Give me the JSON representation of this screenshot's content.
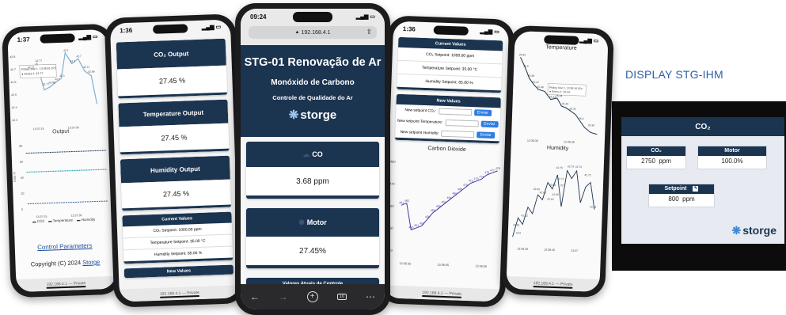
{
  "page": {
    "display_label": "DISPLAY STG-IHM"
  },
  "phone1": {
    "time": "1:37",
    "tooltip_line1": "Friday, Mar 1, 13:36:51.073",
    "tooltip_line2": "● Series 1: 42.77",
    "top_labels": [
      "42.77",
      "42.77",
      "42.77",
      "42.88",
      "42.1",
      "42.1",
      "42.1",
      "42.1",
      "42.7",
      "42.71",
      "42.66"
    ],
    "top_ticks_y": [
      "42.8",
      "42.7",
      "42.6",
      "42.5",
      "42.4",
      "42.3"
    ],
    "top_ticks_x": [
      "13:37:15",
      "13:37:30"
    ],
    "output_title": "Output",
    "output_ticks_y": [
      "80",
      "60",
      "40",
      "20",
      "0"
    ],
    "output_ylabel": "Data %",
    "output_ticks_x": [
      "13:37:15",
      "13:37:30"
    ],
    "legend": [
      "CO2",
      "Temperature",
      "Humidity"
    ],
    "link_text": "Control Parameters",
    "copyright_text": "Copyright (C) 2024 ",
    "copyright_link": "Storge",
    "url": "192.168.4.1 — Private"
  },
  "phone2": {
    "time": "1:36",
    "co2_title": "CO₂ Output",
    "co2_value": "27.45 %",
    "temp_title": "Temperature Output",
    "temp_value": "27.45 %",
    "hum_title": "Humidity Output",
    "hum_value": "27.45 %",
    "current_title": "Current Values",
    "co2_setpoint": "CO₂ Setpoint: 1000.00 ppm",
    "temp_setpoint": "Temperature Setpoint: 35.00 °C",
    "hum_setpoint": "Humidity Setpoint: 85.00 %",
    "new_values_title": "New Values",
    "url": "192.168.4.1 — Private"
  },
  "phone3": {
    "time": "09:24",
    "url": "192.168.4.1",
    "hero_title": "STG-01 Renovação de Ar",
    "hero_sub1": "Monóxido de Carbono",
    "hero_sub2": "Controle de Qualidade do Ar",
    "brand": "storge",
    "co_title": "CO",
    "co_value": "3.68 ppm",
    "motor_title": "Motor",
    "motor_value": "27.45%",
    "current_title": "Valores Atuais de Controle",
    "tab_count": "10"
  },
  "phone4": {
    "time": "1:36",
    "current_title": "Current Values",
    "co2_setpoint": "CO₂ Setpoint: 1000.00 ppm",
    "temp_setpoint": "Temperature Setpoint: 35.00 °C",
    "hum_setpoint": "Humidity Setpoint: 85.00 %",
    "new_values_title": "New Values",
    "new_co2_label": "New setpoint CO₂:",
    "new_temp_label": "New setpoint Temperature:",
    "new_hum_label": "New setpoint Humidity:",
    "send_label": "Enviar",
    "chart_title": "Carbon Dioxide",
    "chart_ticks_y": [
      "480",
      "470",
      "460",
      "450",
      "440"
    ],
    "chart_ticks_x": [
      "13:36:30",
      "13:36:45",
      "13:36:55"
    ],
    "point_labels": [
      "461",
      "462",
      "450",
      "451",
      "452",
      "455",
      "458",
      "460",
      "462",
      "464",
      "466",
      "468",
      "470",
      "472",
      "473",
      "474",
      "476",
      "477",
      "478"
    ],
    "url": "192.168.4.1 — Private"
  },
  "phone5": {
    "temp_title": "Temperature",
    "tooltip_line1": "Friday, Mar 1, 13:36:16.024",
    "tooltip_line2": "● Series 1: 25.44",
    "temp_labels": [
      "25.63",
      "25.5",
      "25.48",
      "25.47",
      "25.46",
      "25.44",
      "25.44",
      "25.43",
      "25.41",
      "25.4",
      "25.39"
    ],
    "temp_ticks_x": [
      "13:36:30",
      "13:36:45"
    ],
    "hum_title": "Humidity",
    "hum_labels": [
      "42.75",
      "42.74",
      "42.73",
      "42.72",
      "42.71",
      "42.7",
      "42.69",
      "42.68",
      "42.66",
      "42.65",
      "42.64",
      "42.63",
      "42.62",
      "42.61",
      "42.6"
    ],
    "hum_ticks_x": [
      "13:36:30",
      "13:36:45",
      "13:37"
    ],
    "url": "192.168.4.1 — Private"
  },
  "hmi": {
    "title": "CO₂",
    "co2_label": "CO₂",
    "co2_value": "2750",
    "co2_unit": "ppm",
    "motor_label": "Motor",
    "motor_value": "100.0%",
    "setpoint_label": "Setpoint",
    "setpoint_value": "800",
    "setpoint_unit": "ppm",
    "brand": "storge"
  },
  "colors": {
    "navy": "#1b3450",
    "accent": "#2f7de1",
    "display_label": "#2d5fa8"
  }
}
